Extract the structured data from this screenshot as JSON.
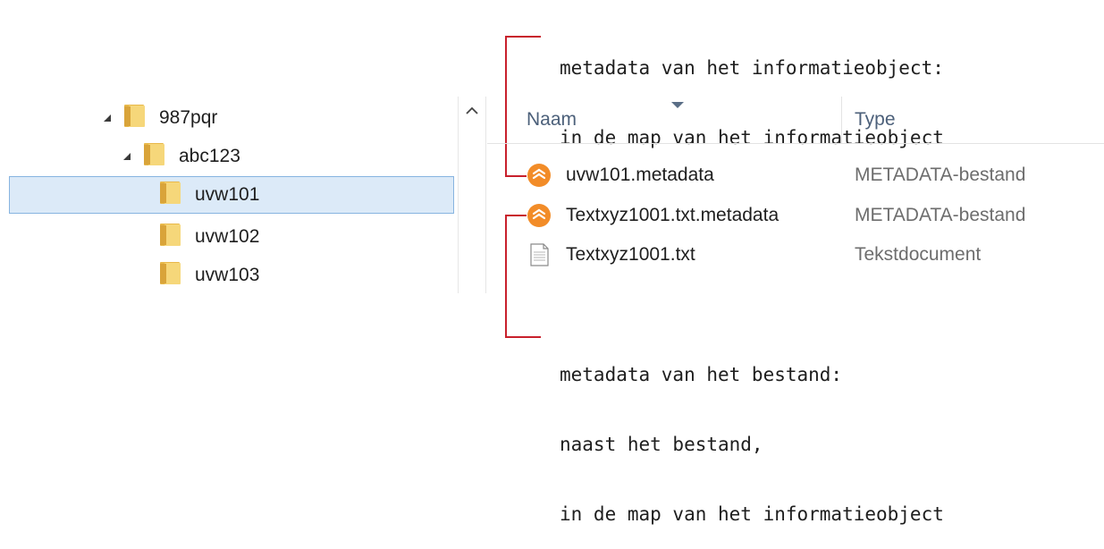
{
  "annotations": {
    "top": {
      "line1": "metadata van het informatieobject:",
      "line2": "in de map van het informatieobject"
    },
    "bottom": {
      "line1": "metadata van het bestand:",
      "line2": "naast het bestand,",
      "line3": "in de map van het informatieobject"
    }
  },
  "tree": {
    "items": [
      {
        "label": "987pqr",
        "level": 0,
        "expanded": true,
        "icon": "folder-icon"
      },
      {
        "label": "abc123",
        "level": 1,
        "expanded": true,
        "icon": "folder-icon"
      },
      {
        "label": "uvw101",
        "level": 2,
        "selected": true,
        "icon": "folder-icon"
      },
      {
        "label": "uvw102",
        "level": 2,
        "icon": "folder-icon"
      },
      {
        "label": "uvw103",
        "level": 2,
        "icon": "folder-icon"
      }
    ]
  },
  "file_list": {
    "columns": {
      "name": "Naam",
      "type": "Type"
    },
    "rows": [
      {
        "name": "uvw101.metadata",
        "type": "METADATA-bestand",
        "icon": "metadata-file-icon"
      },
      {
        "name": "Textxyz1001.txt.metadata",
        "type": "METADATA-bestand",
        "icon": "metadata-file-icon"
      },
      {
        "name": "Textxyz1001.txt",
        "type": "Tekstdocument",
        "icon": "text-document-icon"
      }
    ]
  },
  "colors": {
    "annotation_bracket": "#c8202c",
    "selection_bg": "#dceaf8",
    "selection_border": "#87b4e0",
    "header_text": "#4c607a",
    "metadata_icon": "#f28c28"
  }
}
